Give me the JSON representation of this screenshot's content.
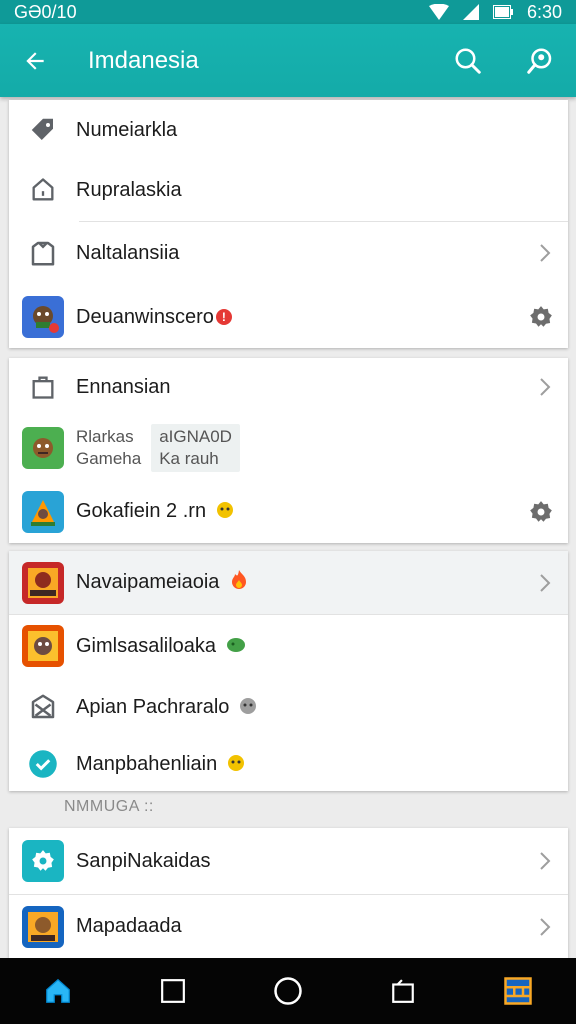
{
  "status": {
    "carrier": "GƏ0/10",
    "time": "6:30"
  },
  "app_bar": {
    "title": "Imdanesia"
  },
  "card1": {
    "items": [
      {
        "label": "Numeiarkla"
      },
      {
        "label": "Rupralaskia"
      },
      {
        "label": "Naltalansiia"
      },
      {
        "label": "Deuanwinscero",
        "badge": "!"
      }
    ]
  },
  "card2": {
    "items": [
      {
        "label": "Ennansian"
      },
      {
        "line1": "Rlarkas",
        "line2": "Gameha",
        "box_line1": "aIGNA0D",
        "box_line2": "Ka rauh"
      },
      {
        "label": "Gokafiein 2 .rn"
      }
    ]
  },
  "card3": {
    "items": [
      {
        "label": "Navaipameiaoia"
      },
      {
        "label": "Gimlsasaliloaka"
      },
      {
        "label": "Apian Pachraralo"
      },
      {
        "label": "Manpbahenliain"
      }
    ]
  },
  "section": {
    "header": "NMMUGA ::"
  },
  "card4": {
    "items": [
      {
        "label": "SanpiNakaidas"
      },
      {
        "label": "Mapadaada"
      }
    ]
  },
  "colors": {
    "primary": "#17b3b0",
    "status_bar": "#0f9a98",
    "accent": "#1ab5c2"
  },
  "icons": {
    "status": [
      "wifi-icon",
      "signal-icon",
      "battery-icon"
    ],
    "app_bar": [
      "back-arrow-icon",
      "search-icon",
      "account-search-icon"
    ],
    "nav": [
      "home-icon",
      "recents-square-icon",
      "home-circle-icon",
      "back-icon",
      "app-grid-icon"
    ]
  }
}
